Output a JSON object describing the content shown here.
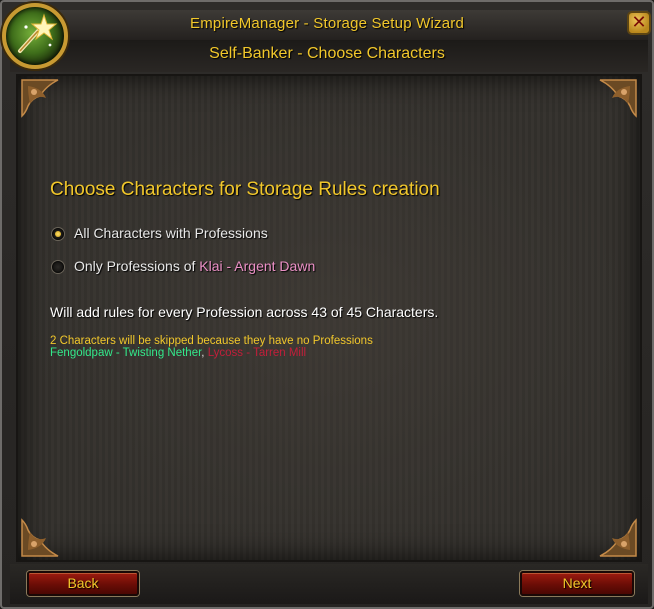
{
  "window": {
    "title": "EmpireManager - Storage Setup Wizard",
    "subtitle": "Self-Banker - Choose Characters",
    "close_glyph": "✕"
  },
  "logo": {
    "icon": "magic-wand-icon"
  },
  "content": {
    "heading": "Choose Characters for Storage Rules creation",
    "options": [
      {
        "label": "All Characters with Professions",
        "selected": true
      },
      {
        "label_prefix": "Only Professions of ",
        "character": "Klai - Argent Dawn",
        "selected": false
      }
    ],
    "summary": "Will add rules for every Profession across 43 of 45 Characters.",
    "skip_note": "2 Characters will be skipped because they have no Professions",
    "skipped_characters": [
      {
        "name": "Fengoldpaw - Twisting Nether",
        "color": "#33e98b"
      },
      {
        "name": "Lycoss - Tarren Mill",
        "color": "#c21e3a"
      }
    ],
    "skipped_separator": ", "
  },
  "buttons": {
    "back": "Back",
    "next": "Next"
  },
  "colors": {
    "accent_gold": "#f1c72b",
    "button_red": "#9e1b10",
    "character_pink": "#ea8fc5"
  }
}
